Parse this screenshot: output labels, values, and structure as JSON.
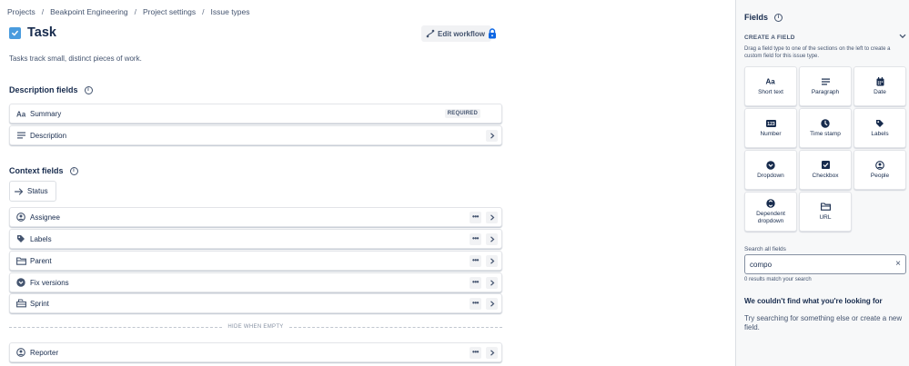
{
  "breadcrumb": [
    "Projects",
    "Beakpoint Engineering",
    "Project settings",
    "Issue types"
  ],
  "breadcrumb_separator": "/",
  "page": {
    "title": "Task",
    "description": "Tasks track small, distinct pieces of work.",
    "edit_workflow_label": "Edit workflow"
  },
  "description_fields": {
    "heading": "Description fields",
    "info_glyph": "i",
    "summary_label": "Summary",
    "summary_badge": "REQUIRED",
    "description_label": "Description"
  },
  "context_fields": {
    "heading": "Context fields",
    "info_glyph": "i",
    "status_label": "Status",
    "items": [
      {
        "label": "Assignee",
        "icon": "person-circle-icon"
      },
      {
        "label": "Labels",
        "icon": "tag-icon"
      },
      {
        "label": "Parent",
        "icon": "folder-icon"
      },
      {
        "label": "Fix versions",
        "icon": "chevron-circle-icon"
      },
      {
        "label": "Sprint",
        "icon": "sprint-icon"
      }
    ],
    "hide_when_empty": "HIDE WHEN EMPTY",
    "hidden_items": [
      {
        "label": "Reporter",
        "icon": "person-circle-icon"
      }
    ],
    "more_glyph": "•••"
  },
  "panel": {
    "title": "Fields",
    "info_glyph": "i",
    "create_heading": "CREATE A FIELD",
    "create_hint": "Drag a field type to one of the sections on the left to create a custom field for this issue type.",
    "tiles": [
      {
        "label": "Short text",
        "icon": "text-aa-icon"
      },
      {
        "label": "Paragraph",
        "icon": "paragraph-icon"
      },
      {
        "label": "Date",
        "icon": "calendar-icon"
      },
      {
        "label": "Number",
        "icon": "number-icon"
      },
      {
        "label": "Time stamp",
        "icon": "clock-icon"
      },
      {
        "label": "Labels",
        "icon": "tag-icon"
      },
      {
        "label": "Dropdown",
        "icon": "dropdown-icon"
      },
      {
        "label": "Checkbox",
        "icon": "checkbox-icon"
      },
      {
        "label": "People",
        "icon": "person-circle-icon"
      },
      {
        "label": "Dependent dropdown",
        "icon": "dependent-dropdown-icon"
      },
      {
        "label": "URL",
        "icon": "url-icon"
      }
    ],
    "search_label": "Search all fields",
    "search_value": "compo",
    "clear_glyph": "×",
    "search_result": "0 results match your search",
    "empty_title": "We couldn't find what you're looking for",
    "empty_text": "Try searching for something else or create a new field."
  },
  "colors": {
    "task_icon": "#4a9cde",
    "lock_icon": "#0c66e4",
    "text_primary": "#172b4d",
    "text_subtle": "#44546f",
    "panel_bg": "#f7f8f9"
  }
}
